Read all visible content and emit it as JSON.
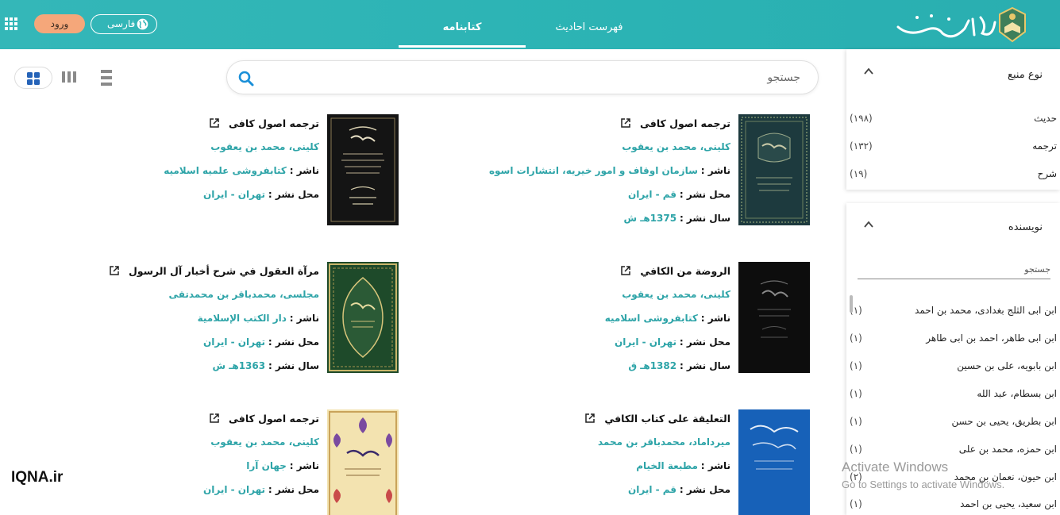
{
  "header": {
    "login_label": "ورود",
    "language_label": "فارسی",
    "tabs": [
      {
        "label": "فهرست احادیث"
      },
      {
        "label": "کتابنامه"
      }
    ],
    "logo_text": "جامع الاحادیث",
    "colors": {
      "bar": "#2fb5b6",
      "login": "#f5a77a",
      "accent": "#2ea4a8"
    }
  },
  "toolbar": {
    "search_placeholder": "جستجو",
    "view_modes": [
      "grid-icon",
      "columns-icon",
      "list-icon"
    ]
  },
  "books": [
    {
      "title": "ترجمه اصول کافی",
      "author": "کلینی، محمد بن یعقوب",
      "publisher_key": "ناشر :",
      "publisher": "سازمان اوقاف و امور خیریه، انتشارات اسوه",
      "place_key": "محل نشر :",
      "place": "قم - ایران",
      "year_key": "سال نشر :",
      "year": "1375هـ ش"
    },
    {
      "title": "ترجمه اصول کافی",
      "author": "کلینی، محمد بن یعقوب",
      "publisher_key": "ناشر :",
      "publisher": "کتابفروشی علمیه اسلامیه",
      "place_key": "محل نشر :",
      "place": "تهران - ایران"
    },
    {
      "title": "الروضة من الكافي",
      "author": "کلینی، محمد بن یعقوب",
      "publisher_key": "ناشر :",
      "publisher": "کتابفروشی اسلامیه",
      "place_key": "محل نشر :",
      "place": "تهران - ایران",
      "year_key": "سال نشر :",
      "year": "1382هـ ق"
    },
    {
      "title": "مرآة العقول في شرح أخبار آل الرسول",
      "author": "مجلسی، محمدباقر بن محمدتقی",
      "publisher_key": "ناشر :",
      "publisher": "دار الکتب الإسلامیة",
      "place_key": "محل نشر :",
      "place": "تهران - ایران",
      "year_key": "سال نشر :",
      "year": "1363هـ ش"
    },
    {
      "title": "التعليقة على كتاب الكافي",
      "author": "میرداماد، محمدباقر بن محمد",
      "publisher_key": "ناشر :",
      "publisher": "مطبعة الخیام",
      "place_key": "محل نشر :",
      "place": "قم - ایران"
    },
    {
      "title": "ترجمه اصول کافی",
      "author": "کلینی، محمد بن یعقوب",
      "publisher_key": "ناشر :",
      "publisher": "جهان آرا",
      "place_key": "محل نشر :",
      "place": "تهران - ایران"
    }
  ],
  "sidebar": {
    "source_type": {
      "title": "نوع منبع",
      "items": [
        {
          "name": "حدیث",
          "count": "(۱۹۸)"
        },
        {
          "name": "ترجمه",
          "count": "(۱۳۲)"
        },
        {
          "name": "شرح",
          "count": "(۱۹)"
        }
      ]
    },
    "author": {
      "title": "نویسنده",
      "filter_placeholder": "جستجو",
      "items": [
        {
          "name": "ابن ابی الثلج بغدادی، محمد بن احمد",
          "count": "(۱)"
        },
        {
          "name": "ابن ابی طاهر، احمد بن ابی طاهر",
          "count": "(۱)"
        },
        {
          "name": "ابن بابویه، علی بن حسین",
          "count": "(۱)"
        },
        {
          "name": "ابن بسطام، عبد الله",
          "count": "(۱)"
        },
        {
          "name": "ابن بطریق، یحیی بن حسن",
          "count": "(۱)"
        },
        {
          "name": "ابن حمزه، محمد بن علی",
          "count": "(۱)"
        },
        {
          "name": "ابن حیون، نعمان بن محمد",
          "count": "(۲)"
        },
        {
          "name": "ابن سعید، یحیی بن احمد",
          "count": "(۱)"
        }
      ]
    }
  },
  "overlay": {
    "watermark": "IQNA.ir",
    "activate_title": "Activate Windows",
    "activate_sub": "Go to Settings to activate Windows."
  }
}
